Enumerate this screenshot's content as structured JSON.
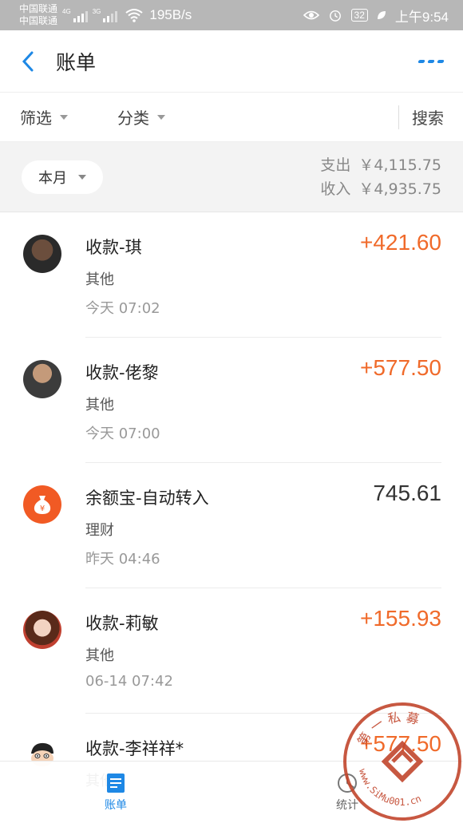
{
  "status_bar": {
    "carrier_1": "中国联通",
    "carrier_2": "中国联通",
    "net_tag_1": "4G",
    "net_tag_2": "3G",
    "speed": "195B/s",
    "battery": "32",
    "time": "上午9:54"
  },
  "header": {
    "title": "账单",
    "back_icon": "chevron-left-icon",
    "more_icon": "more-dots-icon"
  },
  "filters": {
    "filter_label": "筛选",
    "category_label": "分类",
    "search_label": "搜索"
  },
  "summary": {
    "period": "本月",
    "expense_label": "支出",
    "expense_value": "￥4,115.75",
    "income_label": "收入",
    "income_value": "￥4,935.75"
  },
  "transactions": [
    {
      "name": "收款-琪",
      "category": "其他",
      "time": "今天  07:02",
      "amount": "+421.60",
      "type": "income"
    },
    {
      "name": "收款-佬黎",
      "category": "其他",
      "time": "今天  07:00",
      "amount": "+577.50",
      "type": "income"
    },
    {
      "name": "余额宝-自动转入",
      "category": "理财",
      "time": "昨天  04:46",
      "amount": "745.61",
      "type": "transfer"
    },
    {
      "name": "收款-莉敏",
      "category": "其他",
      "time": "06-14  07:42",
      "amount": "+155.93",
      "type": "income"
    },
    {
      "name": "收款-李祥祥*",
      "category": "其他",
      "time": "",
      "amount": "+577.50",
      "type": "income"
    }
  ],
  "bottom_nav": {
    "items": [
      {
        "label": "账单",
        "icon": "bill-icon",
        "active": true
      },
      {
        "label": "统计",
        "icon": "stats-icon",
        "active": false
      }
    ]
  },
  "watermark": {
    "text_top": "第 一 私 募",
    "text_bottom": "www.SiMu001.cn"
  },
  "colors": {
    "accent": "#1e88e5",
    "income": "#f06a2a",
    "statusbar": "#b7b7b7",
    "stamp": "#c2462d"
  }
}
